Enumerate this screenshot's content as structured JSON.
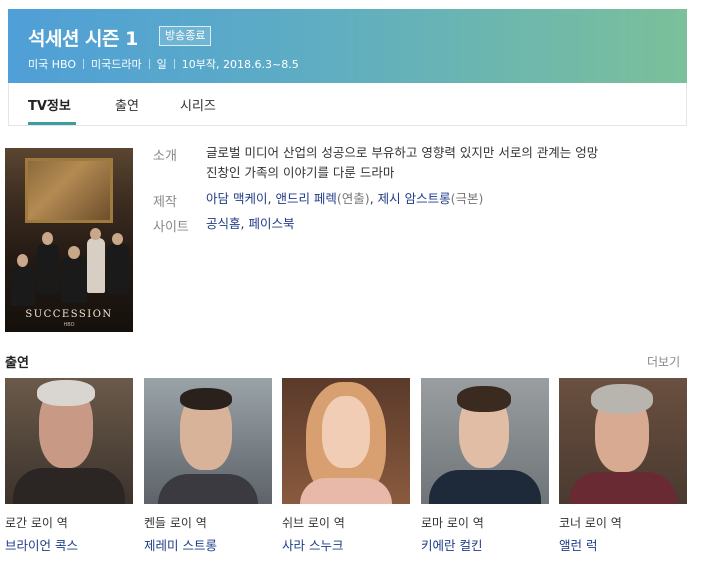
{
  "header": {
    "title": "석세션 시즌 1",
    "badge": "방송종료",
    "meta": [
      "미국 HBO",
      "미국드라마",
      "일",
      "10부작, 2018.6.3~8.5"
    ]
  },
  "tabs": [
    {
      "label": "TV정보",
      "active": true
    },
    {
      "label": "출연",
      "active": false
    },
    {
      "label": "시리즈",
      "active": false
    }
  ],
  "poster": {
    "title": "SUCCESSION",
    "subtitle": "HBO"
  },
  "info": {
    "intro_label": "소개",
    "intro_line1": "글로벌 미디어 산업의 성공으로 부유하고 영향력 있지만 서로의 관계는 엉망",
    "intro_line2": "진창인 가족의 이야기를 다룬 드라마",
    "production_label": "제작",
    "production": [
      {
        "name": "아담 맥케이",
        "suffix": ""
      },
      {
        "name": "앤드리 페렉",
        "suffix": "(연출)"
      },
      {
        "name": "제시 암스트롱",
        "suffix": "(극본)"
      }
    ],
    "site_label": "사이트",
    "sites": [
      "공식홈",
      "페이스북"
    ]
  },
  "cast_section": {
    "heading": "출연",
    "more": "더보기",
    "members": [
      {
        "role": "로간 로이 역",
        "name": "브라이언 콕스"
      },
      {
        "role": "켄들 로이 역",
        "name": "제레미 스트롱"
      },
      {
        "role": "쉬브 로이 역",
        "name": "사라 스누크"
      },
      {
        "role": "로마 로이 역",
        "name": "키에란 컬킨"
      },
      {
        "role": "코너 로이 역",
        "name": "앨런 럭"
      }
    ]
  },
  "colors": {
    "header_gradient_start": "#4f9fd8",
    "header_gradient_end": "#7bc09a",
    "tab_accent": "#3a9e9f",
    "link": "#1f3c88"
  }
}
